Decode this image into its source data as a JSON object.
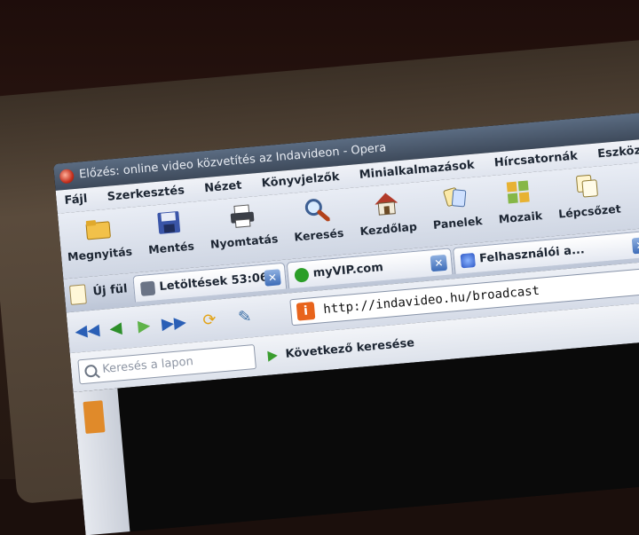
{
  "window": {
    "title": "Előzés: online video közvetítés az Indavideon - Opera"
  },
  "menu": {
    "items": [
      "Fájl",
      "Szerkesztés",
      "Nézet",
      "Könyvjelzők",
      "Minialkalmazások",
      "Hírcsatornák",
      "Eszközök"
    ]
  },
  "toolbar": {
    "buttons": [
      {
        "label": "Megnyitás",
        "icon": "folder-icon"
      },
      {
        "label": "Mentés",
        "icon": "floppy-disk-icon"
      },
      {
        "label": "Nyomtatás",
        "icon": "printer-icon"
      },
      {
        "label": "Keresés",
        "icon": "magnifier-icon"
      },
      {
        "label": "Kezdőlap",
        "icon": "home-icon"
      },
      {
        "label": "Panelek",
        "icon": "panels-icon"
      },
      {
        "label": "Mozaik",
        "icon": "tile-icon"
      },
      {
        "label": "Lépcsőzet",
        "icon": "cascade-icon"
      }
    ]
  },
  "tabs": {
    "new_tab_label": "Új fül",
    "items": [
      {
        "label": "Letöltések 53:06",
        "favicon": "download-icon"
      },
      {
        "label": "myVIP.com",
        "favicon": "myvip-icon"
      },
      {
        "label": "Felhasználói a...",
        "favicon": "opera-user-icon"
      }
    ]
  },
  "navigation": {
    "address": "http://indavideo.hu/broadcast"
  },
  "find": {
    "placeholder": "Keresés a lapon",
    "next_label": "Következő keresése"
  },
  "colors": {
    "accent": "#3d6cb8",
    "site_icon": "#e8641c"
  }
}
